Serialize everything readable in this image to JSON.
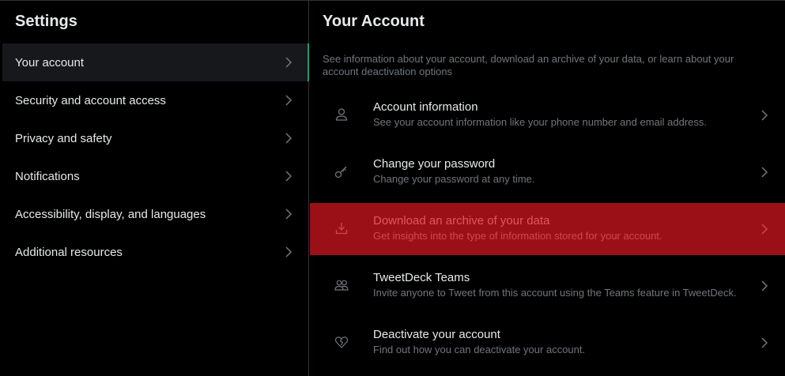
{
  "settings": {
    "title": "Settings",
    "items": [
      {
        "label": "Your account"
      },
      {
        "label": "Security and account access"
      },
      {
        "label": "Privacy and safety"
      },
      {
        "label": "Notifications"
      },
      {
        "label": "Accessibility, display, and languages"
      },
      {
        "label": "Additional resources"
      }
    ]
  },
  "account": {
    "title": "Your Account",
    "description": "See information about your account, download an archive of your data, or learn about your account deactivation options",
    "items": [
      {
        "title": "Account information",
        "subtitle": "See your account information like your phone number and email address.",
        "icon": "person-icon"
      },
      {
        "title": "Change your password",
        "subtitle": "Change your password at any time.",
        "icon": "key-icon"
      },
      {
        "title": "Download an archive of your data",
        "subtitle": "Get insights into the type of information stored for your account.",
        "icon": "download-icon"
      },
      {
        "title": "TweetDeck Teams",
        "subtitle": "Invite anyone to Tweet from this account using the Teams feature in TweetDeck.",
        "icon": "people-icon"
      },
      {
        "title": "Deactivate your account",
        "subtitle": "Find out how you can deactivate your account.",
        "icon": "broken-heart-icon"
      }
    ]
  },
  "colors": {
    "background": "#000000",
    "text_primary": "#e7e9ea",
    "text_secondary": "#71767b",
    "active_bar": "#1d9b6f",
    "highlight_bg": "#9b1016",
    "highlight_text": "#e2555b"
  }
}
